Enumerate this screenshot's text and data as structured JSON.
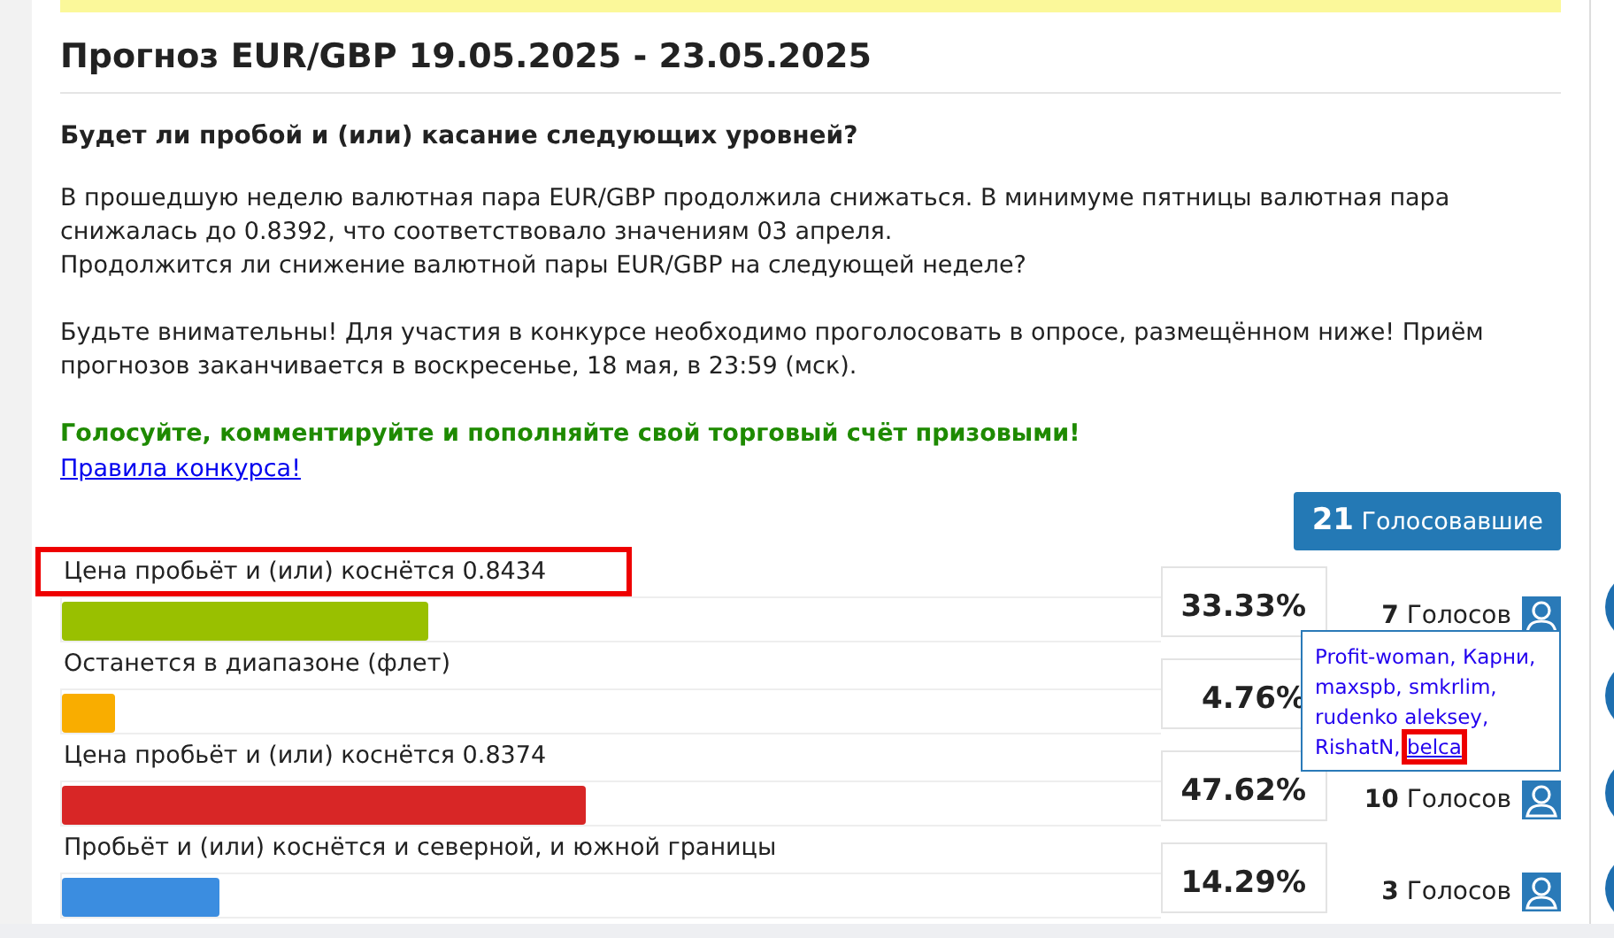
{
  "title": "Прогноз EUR/GBP 19.05.2025 - 23.05.2025",
  "question": "Будет ли пробой и (или) касание следующих уровней?",
  "paragraphs": [
    [
      "В прошедшую неделю валютная пара EUR/GBP продолжила снижаться. В минимуме пятницы валютная пара снижалась до 0.8392, что соответствовало значениям 03 апреля.",
      "Продолжится ли снижение валютной пары EUR/GBP на следующей неделе?"
    ],
    [
      "Будьте внимательны! Для участия в конкурсе необходимо проголосовать в опросе, размещённом ниже! Приём прогнозов заканчивается в воскресенье, 18 мая, в 23:59 (мск)."
    ]
  ],
  "call_to_action": "Голосуйте, комментируйте и пополняйте свой торговый счёт призовыми!",
  "rules_link": "Правила конкурса!",
  "total_voters": {
    "count": "21",
    "label": "Голосовавшие"
  },
  "options": [
    {
      "label": "Цена пробьёт и (или) коснётся 0.8434",
      "highlighted": true,
      "color": "#99c000",
      "level": 0.3333,
      "percent": "33.33%",
      "votes": "7",
      "votes_label": "Голосов",
      "voters_popup": {
        "separator": ", ",
        "voters": [
          {
            "name": "Profit-woman",
            "highlighted": false
          },
          {
            "name": "Карни",
            "highlighted": false
          },
          {
            "name": "maxspb",
            "highlighted": false
          },
          {
            "name": "smkrlim",
            "highlighted": false
          },
          {
            "name": "rudenko aleksey",
            "highlighted": false
          },
          {
            "name": "RishatN",
            "highlighted": false
          },
          {
            "name": "belca",
            "highlighted": true
          }
        ]
      }
    },
    {
      "label": "Останется в диапазоне (флет)",
      "highlighted": false,
      "color": "#f9ad00",
      "level": 0.0476,
      "percent": "4.76%"
    },
    {
      "label": "Цена пробьёт и (или) коснётся 0.8374",
      "highlighted": false,
      "color": "#d82626",
      "level": 0.4762,
      "percent": "47.62%",
      "votes": "10",
      "votes_label": "Голосов"
    },
    {
      "label": "Пробьёт и (или) коснётся и северной, и южной границы",
      "highlighted": false,
      "color": "#3b8de0",
      "level": 0.1429,
      "percent": "14.29%",
      "votes": "3",
      "votes_label": "Голосов"
    }
  ]
}
